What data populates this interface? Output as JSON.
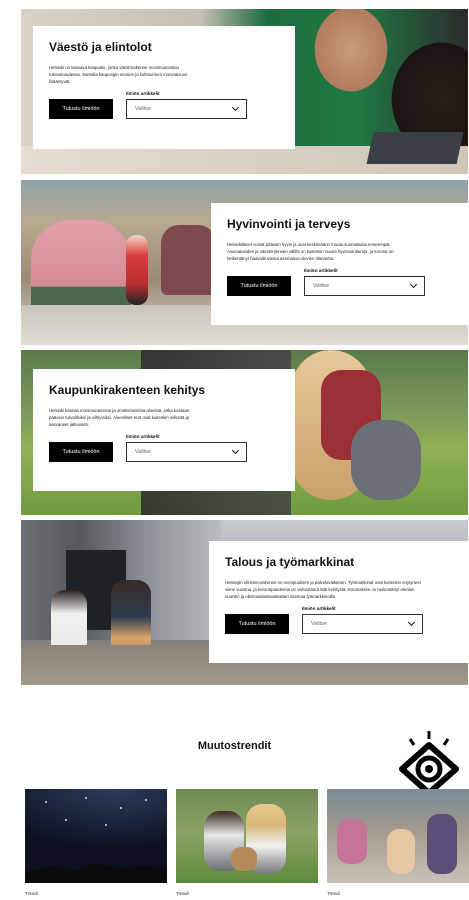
{
  "sections": [
    {
      "title": "Väestö ja elintolot",
      "text": "Helsinki on kasvava kaupunki, jonka väestörakenne monimuotoistuu tulevaisuudessa. Samalla kaupungin etninen ja kulttuurinen moninaisuus lisääntyvät.",
      "button_label": "Tutustu ilmiöön",
      "select_label": "Ilmiön artikkelit",
      "select_value": "Valitse"
    },
    {
      "title": "Hyvinvointi ja terveys",
      "text": "Helsinkiläiset voivat pääosin hyvin ja ovat keskimäärin muuta suomalaisia terveempiä. Asuinalueiden ja väestöryhmien välillä on kuitenkin suuria hyvinvointieroja, ja korona on heikentänyt haavoittuvassa asemassa olevien tilannetta.",
      "button_label": "Tutustu ilmiöön",
      "select_label": "Ilmiön artikkelit",
      "select_value": "Valitse"
    },
    {
      "title": "Kaupunkirakenteen kehitys",
      "text": "Helsinki kasvaa monimuotoisista ja omaleimaisista alueista, jotka koetaan pääosin turvallisiksi ja viihtyisiksi. Alueelliset erot ovat kuitenkin selkeitä ja kasvaneet jatkuvasti.",
      "button_label": "Tutustu ilmiöön",
      "select_label": "Ilmiön artikkelit",
      "select_value": "Valitse"
    },
    {
      "title": "Talous ja työmarkkinat",
      "text": "Helsingin elinkeinorakenne on monipuolinen ja palveluvaltainen. Työmarkkinat ovat kuitenkin eriytyneet viime vuosina, ja koronapandemia on vahvistanut tätä kehitystä. Koronakriisi on heikentänyt etenkin nuorten ja ulkomaalaistaustaisten asemaa työmarkkinoilla.",
      "button_label": "Tutustu ilmiöön",
      "select_label": "Ilmiön artikkelit",
      "select_value": "Valitse"
    }
  ],
  "trends": {
    "heading": "Muutostrendit",
    "cards": [
      {
        "caption": "Trendi"
      },
      {
        "caption": "Trendi"
      },
      {
        "caption": "Trendi"
      }
    ]
  }
}
